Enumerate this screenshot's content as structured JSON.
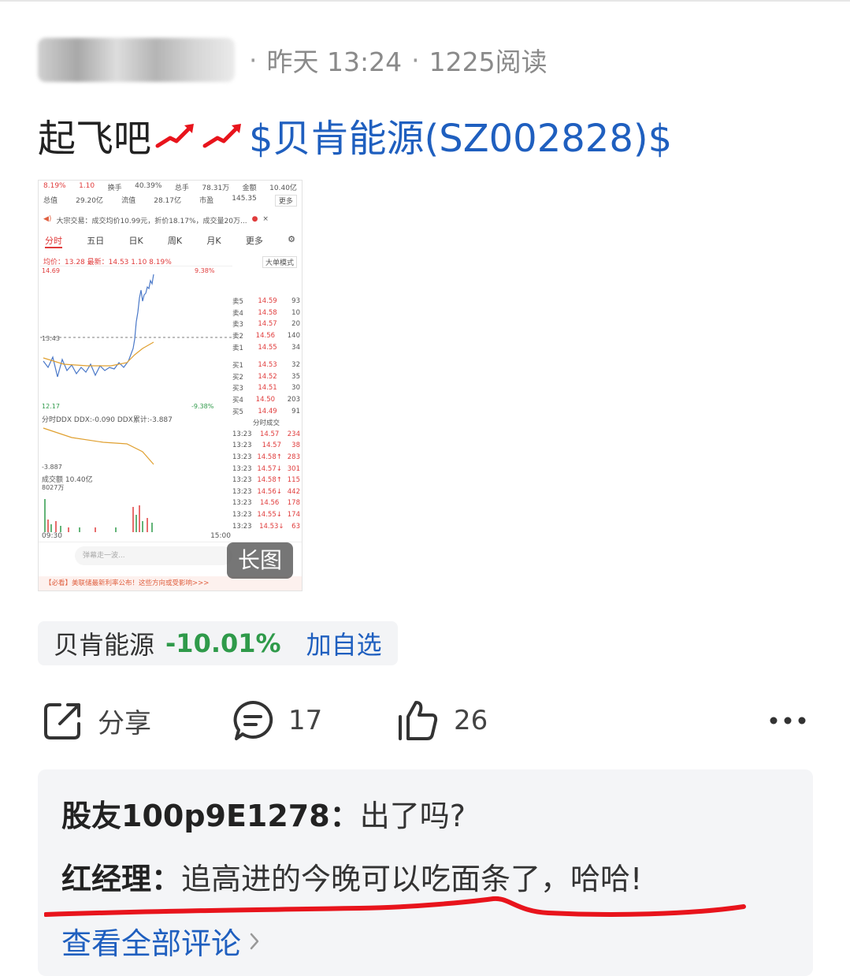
{
  "post": {
    "meta_time": "昨天 13:24",
    "meta_reads": "1225阅读",
    "text_prefix": "起飞吧",
    "stock_link": "$贝肯能源(SZ002828)$",
    "image_badge": "长图"
  },
  "thumb": {
    "row1": [
      "8.19%",
      "1.10",
      "换手",
      "40.39%",
      "总手",
      "78.31万",
      "金额",
      "10.40亿"
    ],
    "row2": [
      "总值",
      "29.20亿",
      "流值",
      "28.17亿",
      "市盈",
      "145.35",
      "更多"
    ],
    "notice": "大宗交易：成交均价10.99元，折价18.17%，成交量20万...",
    "tabs": [
      "分时",
      "五日",
      "日K",
      "周K",
      "月K",
      "更多"
    ],
    "price_line": "均价：13.28 最新：14.53 1.10 8.19%",
    "big_mode": "大单模式",
    "high": "14.69",
    "high_pct": "9.38%",
    "low": "12.17",
    "low_pct": "-9.38%",
    "mid": "13.43",
    "ddx_line": "分时DDX  DDX:-0.090 DDX累计:-3.887",
    "ddx_min": "-3.887",
    "vol_label": "成交额  10.40亿",
    "vol_max": "8027万",
    "time_start": "09:30",
    "time_end": "15:00",
    "danmu": "弹幕走一波...",
    "ad": "【必看】美联储最新利率公布！这些方向或受影响>>>",
    "asks": [
      {
        "label": "卖5",
        "price": "14.59",
        "qty": "93"
      },
      {
        "label": "卖4",
        "price": "14.58",
        "qty": "10"
      },
      {
        "label": "卖3",
        "price": "14.57",
        "qty": "20"
      },
      {
        "label": "卖2",
        "price": "14.56",
        "qty": "140"
      },
      {
        "label": "卖1",
        "price": "14.55",
        "qty": "34"
      }
    ],
    "bids": [
      {
        "label": "买1",
        "price": "14.53",
        "qty": "32"
      },
      {
        "label": "买2",
        "price": "14.52",
        "qty": "35"
      },
      {
        "label": "买3",
        "price": "14.51",
        "qty": "30"
      },
      {
        "label": "买4",
        "price": "14.50",
        "qty": "203"
      },
      {
        "label": "买5",
        "price": "14.49",
        "qty": "91"
      }
    ],
    "trades_title": "分时成交",
    "trades": [
      {
        "t": "13:23",
        "p": "14.57",
        "q": "234"
      },
      {
        "t": "13:23",
        "p": "14.57",
        "q": "38"
      },
      {
        "t": "13:23",
        "p": "14.58↑",
        "q": "283"
      },
      {
        "t": "13:23",
        "p": "14.57↓",
        "q": "301"
      },
      {
        "t": "13:23",
        "p": "14.58↑",
        "q": "115"
      },
      {
        "t": "13:23",
        "p": "14.56↓",
        "q": "442"
      },
      {
        "t": "13:23",
        "p": "14.56",
        "q": "178"
      },
      {
        "t": "13:23",
        "p": "14.55↓",
        "q": "174"
      },
      {
        "t": "13:23",
        "p": "14.53↓",
        "q": "63"
      }
    ]
  },
  "stock_chip": {
    "name": "贝肯能源",
    "change": "-10.01%",
    "add_label": "加自选"
  },
  "actions": {
    "share_label": "分享",
    "comments_count": "17",
    "likes_count": "26"
  },
  "comments": [
    {
      "user": "股友100p9E1278：",
      "body": "出了吗?"
    },
    {
      "user": "红经理：",
      "body": "追高进的今晚可以吃面条了，哈哈!"
    }
  ],
  "view_all": "查看全部评论",
  "colors": {
    "link_blue": "#1f5fbf",
    "down_green": "#2f9a4a",
    "up_red": "#e03c3c",
    "underline_red": "#e8141c"
  }
}
